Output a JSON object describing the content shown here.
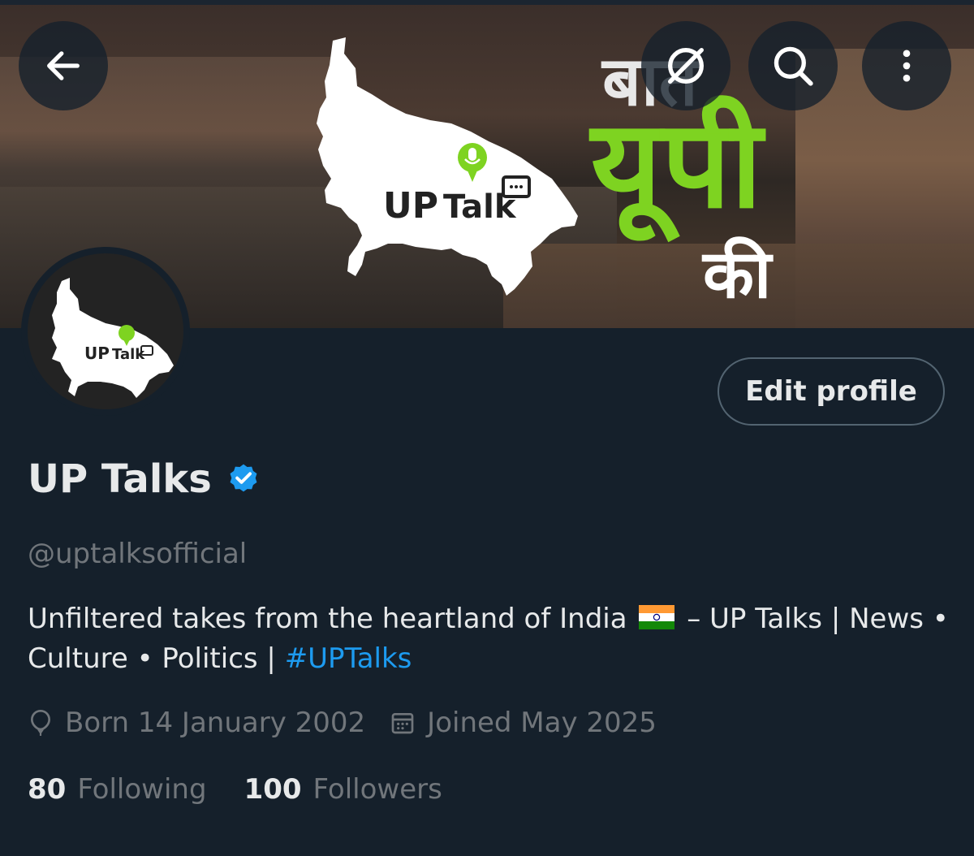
{
  "banner": {
    "hindi_line1": "बात",
    "hindi_line2": "यूपी",
    "hindi_line3": "की",
    "logo_text_up": "UP",
    "logo_text_talk": "Talk"
  },
  "avatar": {
    "logo_text_up": "UP",
    "logo_text_talk": "Talk"
  },
  "nav": {
    "back_icon": "arrow-left-icon",
    "grok_icon": "grok-icon",
    "search_icon": "search-icon",
    "more_icon": "more-vertical-icon"
  },
  "profile": {
    "edit_label": "Edit profile",
    "display_name": "UP Talks",
    "handle": "@uptalksofficial",
    "bio_before_flag": "Unfiltered takes from the heartland of India",
    "bio_after_flag": "– UP Talks | News • Culture • Politics |",
    "bio_hashtag": "#UPTalks",
    "born": "Born 14 January 2002",
    "joined": "Joined May 2025",
    "following_count": "80",
    "following_label": "Following",
    "followers_count": "100",
    "followers_label": "Followers"
  },
  "colors": {
    "background": "#15202b",
    "text_primary": "#e7e9ea",
    "text_secondary": "#71767b",
    "accent_blue": "#1d9bf0",
    "brand_green": "#7ed321"
  }
}
